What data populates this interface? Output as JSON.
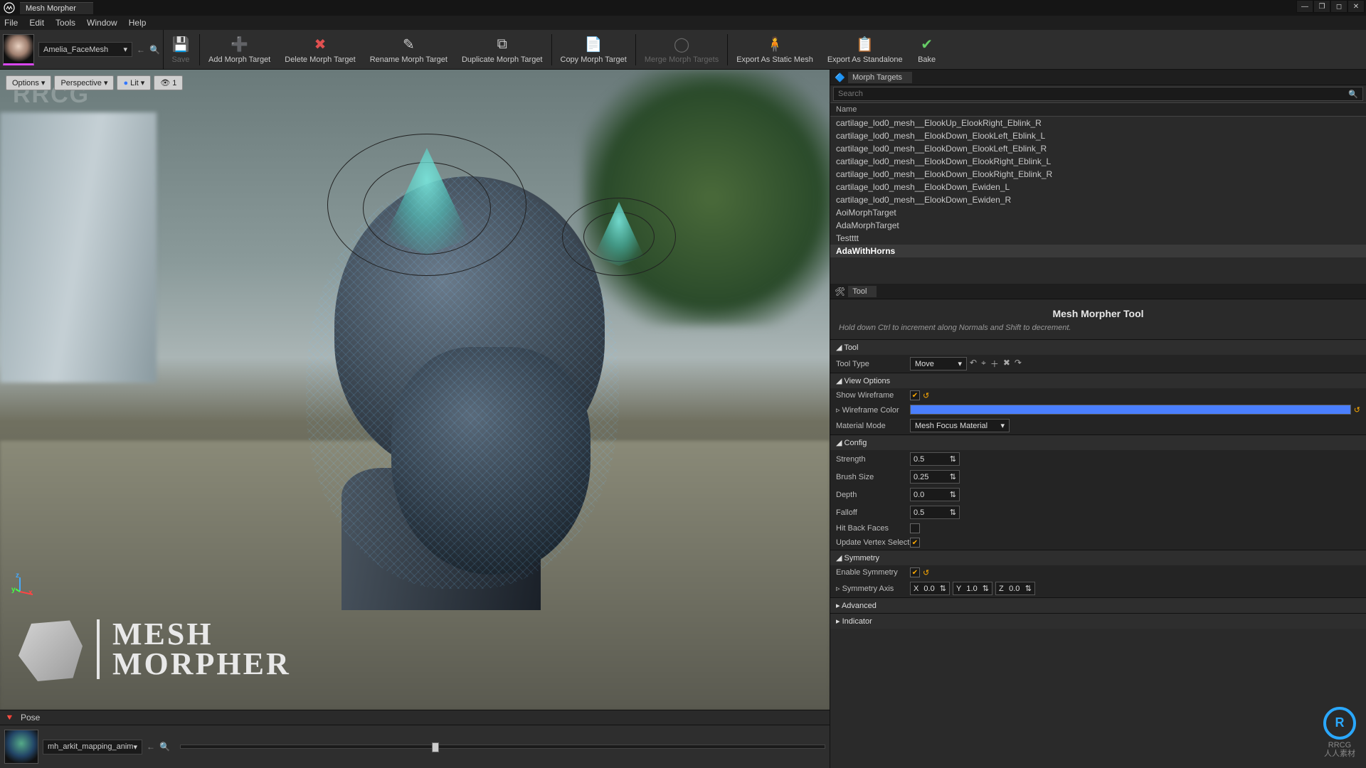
{
  "title_tab": "Mesh Morpher",
  "menus": [
    "File",
    "Edit",
    "Tools",
    "Window",
    "Help"
  ],
  "asset_selected": "Amelia_FaceMesh",
  "toolbar": [
    {
      "id": "save",
      "label": "Save",
      "icon": "💾",
      "disabled": true
    },
    {
      "id": "add",
      "label": "Add Morph Target",
      "icon": "➕"
    },
    {
      "id": "delete",
      "label": "Delete Morph Target",
      "icon": "✖",
      "color": "#e05050"
    },
    {
      "id": "rename",
      "label": "Rename Morph Target",
      "icon": "✎"
    },
    {
      "id": "duplicate",
      "label": "Duplicate Morph Target",
      "icon": "⧉"
    },
    {
      "id": "copy",
      "label": "Copy Morph Target",
      "icon": "📄"
    },
    {
      "id": "merge",
      "label": "Merge Morph Targets",
      "icon": "◯",
      "disabled": true
    },
    {
      "id": "exportstatic",
      "label": "Export As Static Mesh",
      "icon": "🧍"
    },
    {
      "id": "exportstand",
      "label": "Export As Standalone",
      "icon": "📋"
    },
    {
      "id": "bake",
      "label": "Bake",
      "icon": "✔",
      "color": "#6c6"
    }
  ],
  "viewport_buttons": {
    "options": "Options",
    "perspective": "Perspective",
    "lit": "Lit",
    "show_count": "1"
  },
  "pose_label": "Pose",
  "anim_asset": "mh_arkit_mapping_anim",
  "morph_panel": {
    "tab": "Morph Targets",
    "search_placeholder": "Search",
    "name_header": "Name",
    "rows": [
      "cartilage_lod0_mesh__ElookUp_ElookRight_Eblink_R",
      "cartilage_lod0_mesh__ElookDown_ElookLeft_Eblink_L",
      "cartilage_lod0_mesh__ElookDown_ElookLeft_Eblink_R",
      "cartilage_lod0_mesh__ElookDown_ElookRight_Eblink_L",
      "cartilage_lod0_mesh__ElookDown_ElookRight_Eblink_R",
      "cartilage_lod0_mesh__ElookDown_Ewiden_L",
      "cartilage_lod0_mesh__ElookDown_Ewiden_R",
      "AoiMorphTarget",
      "AdaMorphTarget",
      "Testttt",
      "AdaWithHorns"
    ],
    "selected_index": 10
  },
  "tool_panel": {
    "tab": "Tool",
    "title": "Mesh Morpher Tool",
    "hint": "Hold down Ctrl to increment along Normals and Shift to decrement.",
    "sections": {
      "Tool": {
        "Tool Type": "Move"
      },
      "View Options": {
        "Show Wireframe": true,
        "Wireframe Color": "#4a7fff",
        "Material Mode": "Mesh Focus Material"
      },
      "Config": {
        "Strength": "0.5",
        "Brush Size": "0.25",
        "Depth": "0.0",
        "Falloff": "0.5",
        "Hit Back Faces": false,
        "Update Vertex Select": true
      },
      "Symmetry": {
        "Enable Symmetry": true,
        "Symmetry Axis": {
          "X": "0.0",
          "Y": "1.0",
          "Z": "0.0"
        }
      },
      "Advanced": {},
      "Indicator": {}
    }
  },
  "logo": {
    "line1": "MESH",
    "line2": "MORPHER"
  },
  "watermark": "RRCG",
  "corner_mark": {
    "brand": "RRCG",
    "sub": "人人素材"
  }
}
